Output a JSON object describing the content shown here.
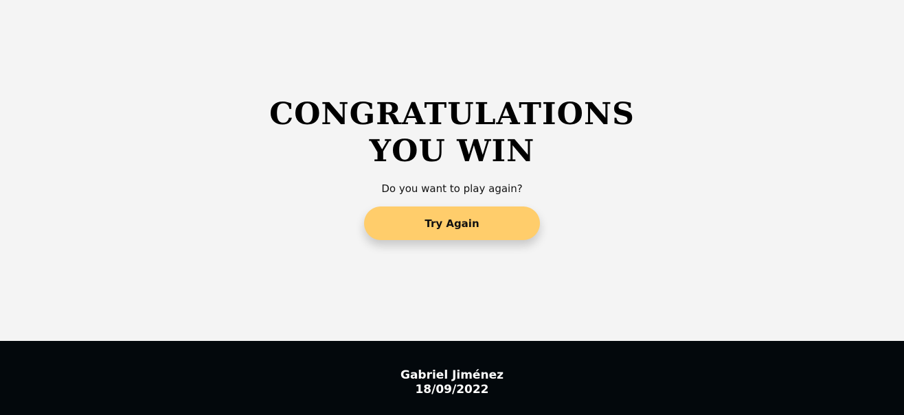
{
  "result": {
    "title_line1": "CONGRATULATIONS",
    "title_line2": "YOU WIN",
    "prompt": "Do you want to play again?",
    "try_again_label": "Try Again"
  },
  "footer": {
    "author": "Gabriel Jiménez",
    "date": "18/09/2022"
  },
  "colors": {
    "background": "#f4f4f4",
    "button": "#ffcd6b",
    "footer_background": "#03080c",
    "footer_text": "#ffffff"
  }
}
